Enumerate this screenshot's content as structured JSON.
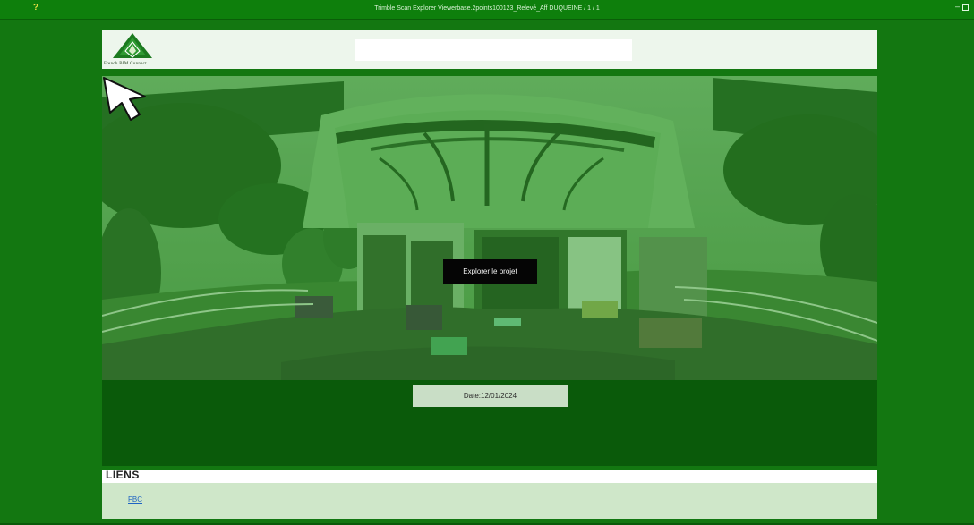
{
  "window": {
    "title": "Trimble Scan Explorer Viewerbase.2points100123_Relevé_Aff DUQUEINE / 1 / 1",
    "help_label": "?",
    "controls": {
      "minimize": "–",
      "maximize": ""
    }
  },
  "header": {
    "brand_name": "French BIM Connect"
  },
  "hero": {
    "action_button": "Explorer le projet"
  },
  "meta": {
    "date_label": "Date:12/01/2024"
  },
  "links": {
    "title": "LIENS",
    "items": [
      {
        "label": "FBC"
      }
    ]
  },
  "colors": {
    "background": "#137711",
    "overlay": "#4f9a46",
    "band_dark": "#0a5a0a",
    "header_band": "#edf6ec",
    "link": "#1e63c3"
  }
}
